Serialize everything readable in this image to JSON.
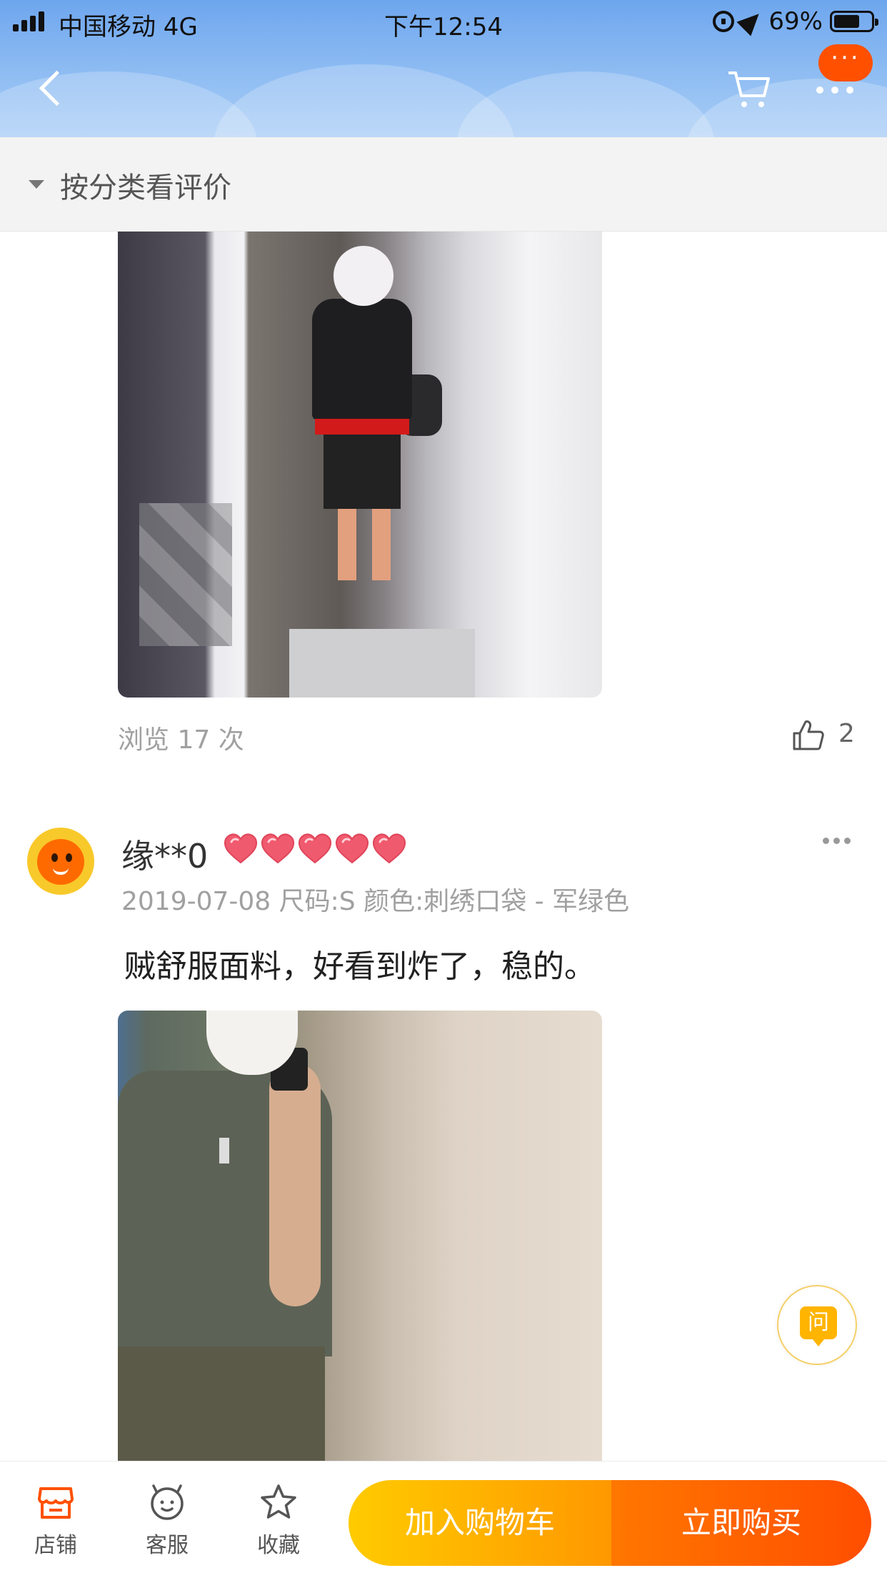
{
  "status_bar": {
    "carrier": "中国移动 4G",
    "time": "下午12:54",
    "battery": "69%",
    "battery_level": 0.69
  },
  "header": {
    "back_icon": "chevron-left-icon",
    "cart_icon": "cart-icon",
    "more_icon": "more-dots-icon",
    "more_badge": "···",
    "bg_color": "#7aaef0"
  },
  "filter": {
    "label": "按分类看评价"
  },
  "review_1": {
    "views": "浏览 17 次",
    "likes": "2"
  },
  "review_2": {
    "username": "缘**0",
    "hearts": 5,
    "meta": "2019-07-08 尺码:S 颜色:刺绣口袋 - 军绿色",
    "text": "贼舒服面料，好看到炸了，稳的。"
  },
  "ask_button": {
    "label": "问"
  },
  "bottom_bar": {
    "shop": "店铺",
    "service": "客服",
    "favorite": "收藏",
    "add_to_cart": "加入购物车",
    "buy_now": "立即购买",
    "accent_orange": "#ff5000",
    "accent_yellow": "#ffcb00"
  }
}
